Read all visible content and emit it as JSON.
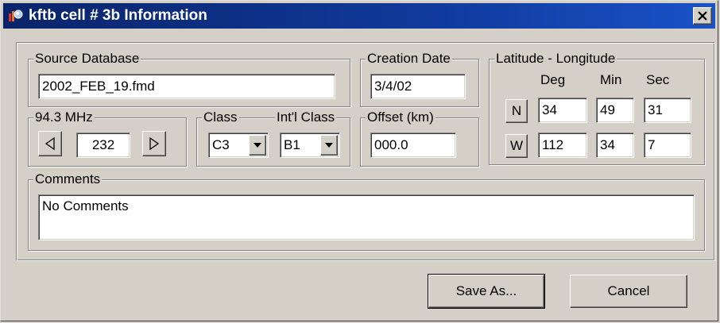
{
  "window": {
    "title": "kftb cell # 3b Information",
    "close_glyph": "✕"
  },
  "source_database": {
    "label": "Source Database",
    "value": "2002_FEB_19.fmd"
  },
  "creation_date": {
    "label": "Creation Date",
    "value": "3/4/02"
  },
  "frequency": {
    "label": "94.3 MHz",
    "channel": "232"
  },
  "class": {
    "label": "Class",
    "value": "C3"
  },
  "intl_class": {
    "label": "Int'l Class",
    "value": "B1"
  },
  "offset": {
    "label": "Offset (km)",
    "value": "000.0"
  },
  "latlon": {
    "label": "Latitude - Longitude",
    "deg_header": "Deg",
    "min_header": "Min",
    "sec_header": "Sec",
    "lat": {
      "hemisphere": "N",
      "deg": "34",
      "min": "49",
      "sec": "31"
    },
    "lon": {
      "hemisphere": "W",
      "deg": "112",
      "min": "34",
      "sec": "7"
    }
  },
  "comments": {
    "label": "Comments",
    "value": "No Comments"
  },
  "buttons": {
    "save_as": "Save As...",
    "cancel": "Cancel"
  },
  "colors": {
    "face": "#d4d0c8",
    "title_active": "#0a246a",
    "title_gradient_end": "#1a52c8"
  },
  "icons": {
    "app": "antenna-tower-icon",
    "close": "close-icon",
    "prev": "triangle-left-icon",
    "next": "triangle-right-icon",
    "dropdown": "chevron-down-icon"
  }
}
